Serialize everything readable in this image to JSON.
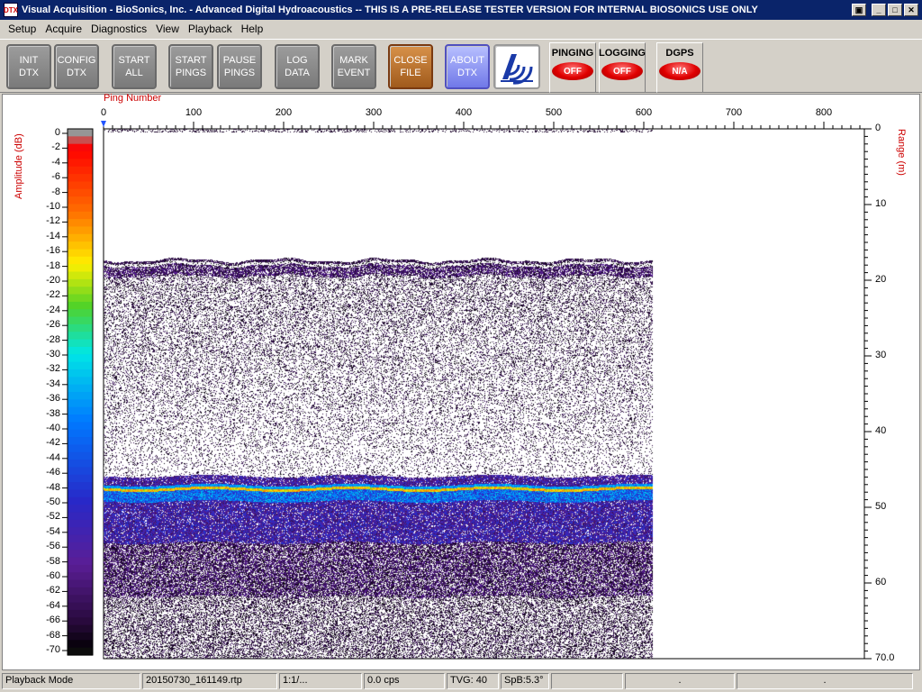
{
  "window": {
    "icon_text": "DTX",
    "title": "Visual Acquisition  -  BioSonics, Inc.  -  Advanced Digital Hydroacoustics  -- THIS IS A PRE-RELEASE TESTER VERSION FOR INTERNAL BIOSONICS USE ONLY",
    "buttons": [
      "restore-icon",
      "minimize-icon",
      "maximize-icon",
      "close-icon"
    ]
  },
  "menu": [
    "Setup",
    "Acquire",
    "Diagnostics",
    "View",
    "Playback",
    "Help"
  ],
  "toolbar": {
    "buttons": [
      {
        "label": "INIT\nDTX",
        "style": "gray"
      },
      {
        "label": "CONFIG\nDTX",
        "style": "gray"
      },
      {
        "label": "START\nALL",
        "style": "gray"
      },
      {
        "label": "START\nPINGS",
        "style": "gray"
      },
      {
        "label": "PAUSE\nPINGS",
        "style": "gray"
      },
      {
        "label": "LOG\nDATA",
        "style": "gray"
      },
      {
        "label": "MARK\nEVENT",
        "style": "gray"
      },
      {
        "label": "CLOSE\nFILE",
        "style": "orange"
      },
      {
        "label": "ABOUT\nDTX",
        "style": "blue"
      }
    ],
    "logo_icon": "biosonics-logo-icon",
    "indicators": [
      {
        "label": "PINGING",
        "state": "OFF"
      },
      {
        "label": "LOGGING",
        "state": "OFF"
      },
      {
        "label": "DGPS",
        "state": "N/A"
      }
    ]
  },
  "echogram": {
    "x_axis_label": "Ping Number",
    "x_ticks": [
      "0",
      "100",
      "200",
      "300",
      "400",
      "500",
      "600",
      "700",
      "800"
    ],
    "y_axis_label": "Range (m)",
    "y_ticks": [
      "0",
      "10",
      "20",
      "30",
      "40",
      "50",
      "60",
      "70.0"
    ],
    "colorbar_label": "Amplitude (dB)",
    "colorbar_ticks": [
      "0",
      "-2",
      "-4",
      "-6",
      "-8",
      "-10",
      "-12",
      "-14",
      "-16",
      "-18",
      "-20",
      "-22",
      "-24",
      "-26",
      "-28",
      "-30",
      "-32",
      "-34",
      "-36",
      "-38",
      "-40",
      "-42",
      "-44",
      "-46",
      "-48",
      "-50",
      "-52",
      "-54",
      "-56",
      "-58",
      "-60",
      "-62",
      "-64",
      "-66",
      "-68",
      "-70"
    ],
    "pings_recorded": 610,
    "max_ping": 845,
    "max_range_m": 70,
    "surface_layer_m": 18,
    "bottom_m": 47.5,
    "accent_colors": {
      "label_red": "#cc0000",
      "bottom_line": "#ff3300"
    }
  },
  "status_bar": [
    "Playback Mode",
    "20150730_161149.rtp",
    "1:1/...",
    "0.0 cps",
    "TVG: 40",
    "SpB:5.3°",
    "",
    ".",
    "."
  ]
}
